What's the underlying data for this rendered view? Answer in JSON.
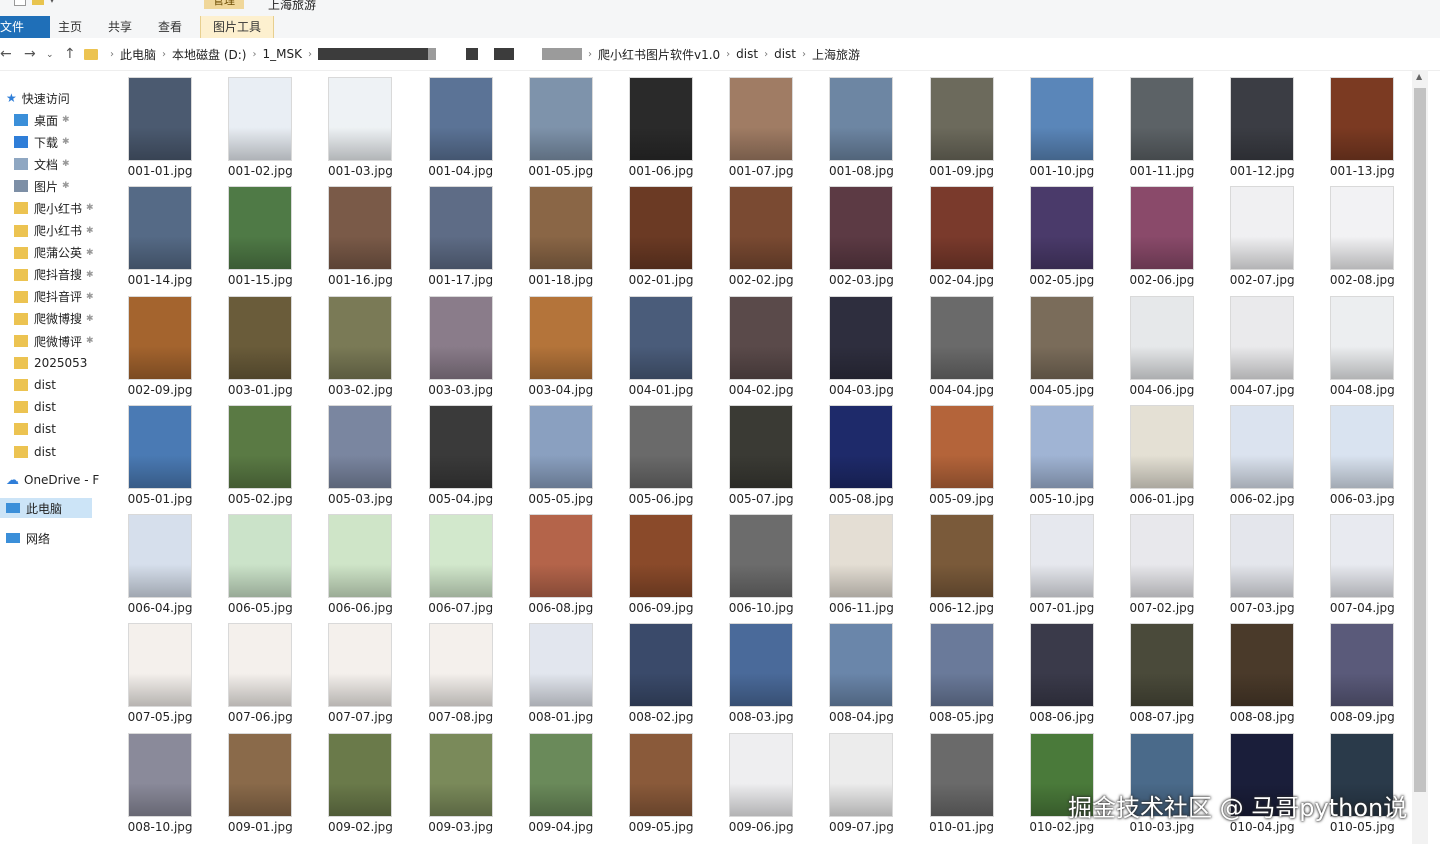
{
  "window_title": "上海旅游",
  "ribbon": {
    "context_label": "管理",
    "tabs": [
      "文件",
      "主页",
      "共享",
      "查看",
      "图片工具"
    ]
  },
  "address": {
    "crumbs": [
      "此电脑",
      "本地磁盘 (D:)",
      "1_MSK",
      "爬小红书图片软件v1.0",
      "dist",
      "dist",
      "上海旅游"
    ]
  },
  "nav_pane": {
    "quick_access": "快速访问",
    "items": [
      {
        "label": "桌面",
        "icon": "desktop-icon"
      },
      {
        "label": "下载",
        "icon": "download-icon"
      },
      {
        "label": "文档",
        "icon": "document-icon"
      },
      {
        "label": "图片",
        "icon": "pictures-icon"
      },
      {
        "label": "爬小红书",
        "icon": "folder-icon"
      },
      {
        "label": "爬小红书",
        "icon": "folder-icon"
      },
      {
        "label": "爬蒲公英",
        "icon": "folder-icon"
      },
      {
        "label": "爬抖音搜",
        "icon": "folder-icon"
      },
      {
        "label": "爬抖音评",
        "icon": "folder-icon"
      },
      {
        "label": "爬微博搜",
        "icon": "folder-icon"
      },
      {
        "label": "爬微博评",
        "icon": "folder-icon"
      },
      {
        "label": "2025053",
        "icon": "folder-icon"
      },
      {
        "label": "dist",
        "icon": "folder-icon"
      },
      {
        "label": "dist",
        "icon": "folder-icon"
      },
      {
        "label": "dist",
        "icon": "folder-icon"
      },
      {
        "label": "dist",
        "icon": "folder-icon"
      }
    ],
    "onedrive": "OneDrive - F",
    "this_pc": "此电脑",
    "network": "网络"
  },
  "files": [
    "001-01.jpg",
    "001-02.jpg",
    "001-03.jpg",
    "001-04.jpg",
    "001-05.jpg",
    "001-06.jpg",
    "001-07.jpg",
    "001-08.jpg",
    "001-09.jpg",
    "001-10.jpg",
    "001-11.jpg",
    "001-12.jpg",
    "001-13.jpg",
    "001-14.jpg",
    "001-15.jpg",
    "001-16.jpg",
    "001-17.jpg",
    "001-18.jpg",
    "002-01.jpg",
    "002-02.jpg",
    "002-03.jpg",
    "002-04.jpg",
    "002-05.jpg",
    "002-06.jpg",
    "002-07.jpg",
    "002-08.jpg",
    "002-09.jpg",
    "003-01.jpg",
    "003-02.jpg",
    "003-03.jpg",
    "003-04.jpg",
    "004-01.jpg",
    "004-02.jpg",
    "004-03.jpg",
    "004-04.jpg",
    "004-05.jpg",
    "004-06.jpg",
    "004-07.jpg",
    "004-08.jpg",
    "005-01.jpg",
    "005-02.jpg",
    "005-03.jpg",
    "005-04.jpg",
    "005-05.jpg",
    "005-06.jpg",
    "005-07.jpg",
    "005-08.jpg",
    "005-09.jpg",
    "005-10.jpg",
    "006-01.jpg",
    "006-02.jpg",
    "006-03.jpg",
    "006-04.jpg",
    "006-05.jpg",
    "006-06.jpg",
    "006-07.jpg",
    "006-08.jpg",
    "006-09.jpg",
    "006-10.jpg",
    "006-11.jpg",
    "006-12.jpg",
    "007-01.jpg",
    "007-02.jpg",
    "007-03.jpg",
    "007-04.jpg",
    "007-05.jpg",
    "007-06.jpg",
    "007-07.jpg",
    "007-08.jpg",
    "008-01.jpg",
    "008-02.jpg",
    "008-03.jpg",
    "008-04.jpg",
    "008-05.jpg",
    "008-06.jpg",
    "008-07.jpg",
    "008-08.jpg",
    "008-09.jpg",
    "008-10.jpg",
    "009-01.jpg",
    "009-02.jpg",
    "009-03.jpg",
    "009-04.jpg",
    "009-05.jpg",
    "009-06.jpg",
    "009-07.jpg",
    "010-01.jpg",
    "010-02.jpg",
    "010-03.jpg",
    "010-04.jpg",
    "010-05.jpg"
  ],
  "thumb_colors": [
    "#4b5a70",
    "#e9eef4",
    "#eef2f5",
    "#5b7396",
    "#7e93ab",
    "#2a2a2a",
    "#a07c64",
    "#6d86a3",
    "#6c6a5c",
    "#5a86b9",
    "#5c6266",
    "#3b3d44",
    "#7b3a22",
    "#556a86",
    "#4f7a46",
    "#7a5a48",
    "#5e6c86",
    "#8a6646",
    "#6b3a24",
    "#7a4a32",
    "#5c3a44",
    "#7a3a2c",
    "#4a3a6a",
    "#8a4a6a",
    "#f0f0f2",
    "#f2f2f4",
    "#a4642e",
    "#6a5c3a",
    "#7a7a56",
    "#8a7c8a",
    "#b4743a",
    "#4a5c7a",
    "#5a4a4a",
    "#2e2e3e",
    "#6a6a6a",
    "#7a6c5a",
    "#e6e8ea",
    "#eaeaec",
    "#eceef0",
    "#4a7ab4",
    "#5a7a44",
    "#7a86a0",
    "#3a3a3a",
    "#8aa0c0",
    "#6a6a6a",
    "#3a3a34",
    "#1e2a6a",
    "#b4643a",
    "#a0b4d4",
    "#e4e0d4",
    "#dbe3ef",
    "#d9e3f0",
    "#d6dfec",
    "#cbe3c9",
    "#cfe5c8",
    "#d2e8cc",
    "#b4644a",
    "#8a4a2a",
    "#6c6c6c",
    "#e4ded4",
    "#7a5a3a",
    "#e6e8ee",
    "#e8e8ec",
    "#e4e6ec",
    "#e8eaf0",
    "#f4f0ec",
    "#f4f0ec",
    "#f4f0ec",
    "#f4f0ec",
    "#e2e6ee",
    "#3a4a6a",
    "#4a6a9a",
    "#6a86aa",
    "#6a7a9a",
    "#3a3a4a",
    "#4a4a3a",
    "#4a3a2a",
    "#5a5a7a",
    "#8a8a9a",
    "#8a6a4a",
    "#6a7a4a",
    "#7a8a5a",
    "#6a8a5a",
    "#8a5a3a",
    "#eeeef0",
    "#ececec",
    "#6a6a6a",
    "#4a7a3a",
    "#4a6a8a",
    "#1a1e3a",
    "#2a3a4a"
  ],
  "watermark": "掘金技术社区 @ 马哥python说"
}
